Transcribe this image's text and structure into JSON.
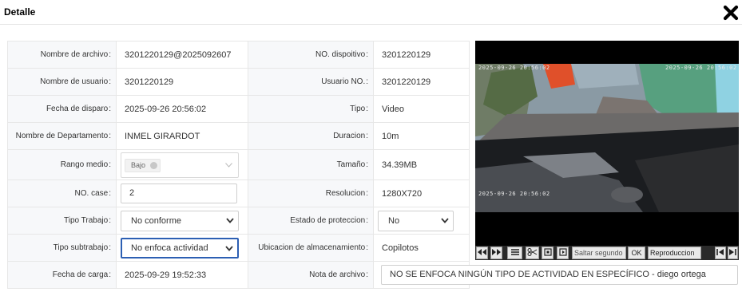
{
  "header": {
    "title": "Detalle",
    "close_icon": "close-icon"
  },
  "details": {
    "nombre_archivo": {
      "label": "Nombre de archivo",
      "value": "3201220129@2025092607"
    },
    "no_dispositivo": {
      "label": "NO. dispoitivo",
      "value": "3201220129"
    },
    "nombre_usuario": {
      "label": "Nombre de usuario",
      "value": "3201220129"
    },
    "usuario_no": {
      "label": "Usuario NO.",
      "value": "3201220129"
    },
    "fecha_disparo": {
      "label": "Fecha de disparo",
      "value": "2025-09-26 20:56:02"
    },
    "tipo": {
      "label": "Tipo",
      "value": "Video"
    },
    "nombre_departamento": {
      "label": "Nombre de Departamento",
      "value": "INMEL GIRARDOT"
    },
    "duracion": {
      "label": "Duracion",
      "value": "10m"
    },
    "rango_medio": {
      "label": "Rango medio",
      "tag": "Bajo"
    },
    "tamano": {
      "label": "Tamaño",
      "value": "34.39MB"
    },
    "no_case": {
      "label": "NO. case",
      "value": "2"
    },
    "resolucion": {
      "label": "Resolucion",
      "value": "1280X720"
    },
    "tipo_trabajo": {
      "label": "Tipo Trabajo",
      "value": "No conforme"
    },
    "estado_proteccion": {
      "label": "Estado de proteccion",
      "value": "No"
    },
    "tipo_subtrabajo": {
      "label": "Tipo subtrabajo",
      "value": "No enfoca actividad"
    },
    "ubicacion": {
      "label": "Ubicacion de almacenamiento",
      "value": "Copilotos"
    },
    "fecha_carga": {
      "label": "Fecha de carga",
      "value": "2025-09-29 19:52:33"
    },
    "nota_archivo": {
      "label": "Nota de archivo",
      "value": "NO SE ENFOCA NINGÚN TIPO DE ACTIVIDAD EN ESPECÍFICO - diego ortega"
    },
    "colon": ":"
  },
  "video": {
    "timestamp_top_left": "2025-09-26 20:56:02",
    "timestamp_top_right": "2025-09-26 20:56:02",
    "timestamp_bottom": "2025-09-26 20:56:02"
  },
  "controls": {
    "prev_icon": "rewind-icon",
    "next_icon": "fast-forward-icon",
    "list_icon": "list-icon",
    "clip_icon": "scissors-icon",
    "snapshot_icon": "snapshot-icon",
    "frame_icon": "frame-icon",
    "skip_placeholder": "Saltar segundo",
    "ok_label": "OK",
    "play_label": "Reproduccion",
    "first_icon": "skip-start-icon",
    "last_icon": "skip-end-icon"
  },
  "colors": {
    "label_bg": "#f7f8fa",
    "focus_border": "#2c5fb3",
    "border": "#e7e7e7"
  }
}
